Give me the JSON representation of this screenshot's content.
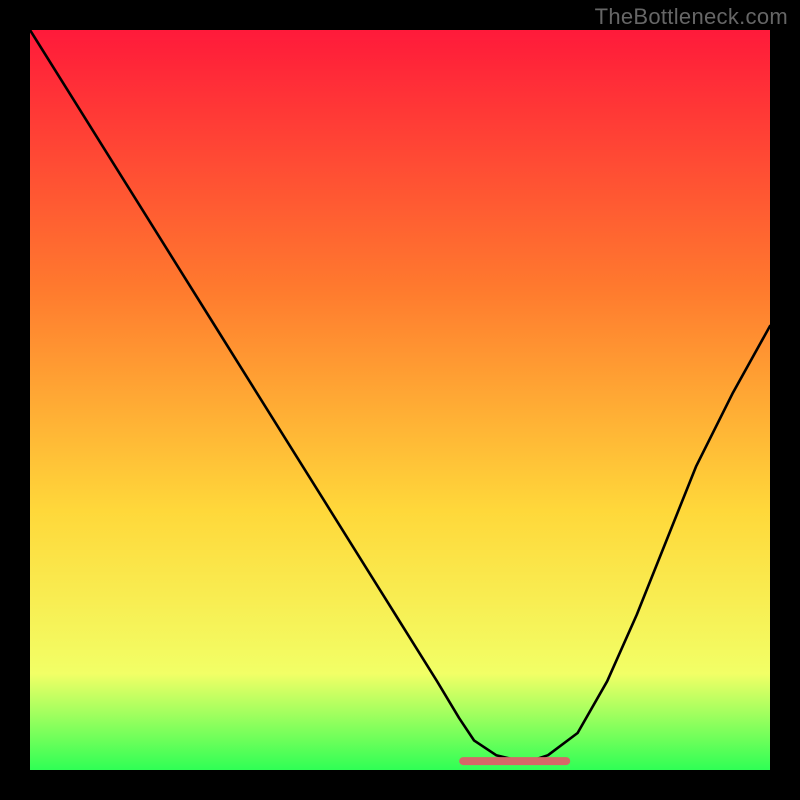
{
  "watermark": "TheBottleneck.com",
  "colors": {
    "top": "#ff1a3a",
    "mid1": "#ff7a2e",
    "mid2": "#ffd83a",
    "mid3": "#f2ff66",
    "bottom": "#2fff55",
    "line": "#000000",
    "pill": "#d56868",
    "bg": "#000000"
  },
  "chart_data": {
    "type": "line",
    "title": "",
    "xlabel": "",
    "ylabel": "",
    "xlim": [
      0,
      100
    ],
    "ylim": [
      0,
      100
    ],
    "series": [
      {
        "name": "curve",
        "x": [
          0,
          5,
          10,
          15,
          20,
          25,
          30,
          35,
          40,
          45,
          50,
          55,
          58,
          60,
          63,
          67,
          70,
          74,
          78,
          82,
          86,
          90,
          95,
          100
        ],
        "values": [
          100,
          92,
          84,
          76,
          68,
          60,
          52,
          44,
          36,
          28,
          20,
          12,
          7,
          4,
          2,
          1,
          2,
          5,
          12,
          21,
          31,
          41,
          51,
          60
        ]
      }
    ],
    "annotations": [
      {
        "name": "minimum-band",
        "x_start": 58,
        "x_end": 73,
        "y": 1.2
      }
    ]
  }
}
